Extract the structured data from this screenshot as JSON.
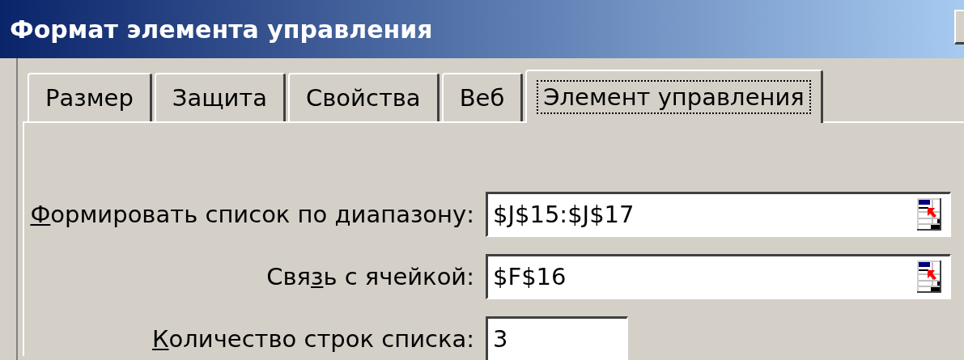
{
  "window": {
    "title": "Формат элемента управления"
  },
  "tabs": [
    {
      "label": "Размер",
      "selected": false
    },
    {
      "label": "Защита",
      "selected": false
    },
    {
      "label": "Свойства",
      "selected": false
    },
    {
      "label": "Веб",
      "selected": false
    },
    {
      "label": "Элемент управления",
      "selected": true
    }
  ],
  "fields": [
    {
      "access_key": "Ф",
      "label_after": "ормировать список по диапазону:",
      "value": "$J$15:$J$17",
      "kind": "range"
    },
    {
      "label_before": "Свя",
      "access_key": "з",
      "label_after": "ь с ячейкой:",
      "value": "$F$16",
      "kind": "range"
    },
    {
      "access_key": "К",
      "label_after": "оличество строк списка:",
      "value": "3",
      "kind": "number"
    }
  ]
}
